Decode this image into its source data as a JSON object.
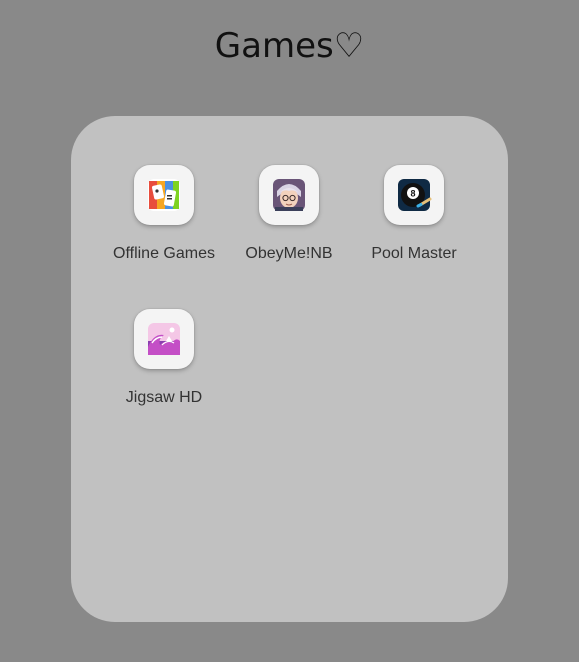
{
  "folder": {
    "title": "Games♡"
  },
  "apps": [
    {
      "label": "Offline Games",
      "icon": "offline-games-icon"
    },
    {
      "label": "ObeyMe!NB",
      "icon": "obeyme-nb-icon"
    },
    {
      "label": "Pool Master",
      "icon": "eight-ball-icon"
    },
    {
      "label": "Jigsaw HD",
      "icon": "great-wave-icon"
    }
  ],
  "colors": {
    "background": "#898989",
    "folder_panel": "#c1c1c1",
    "icon_tile": "#f4f4f4",
    "label_text": "#333333"
  }
}
